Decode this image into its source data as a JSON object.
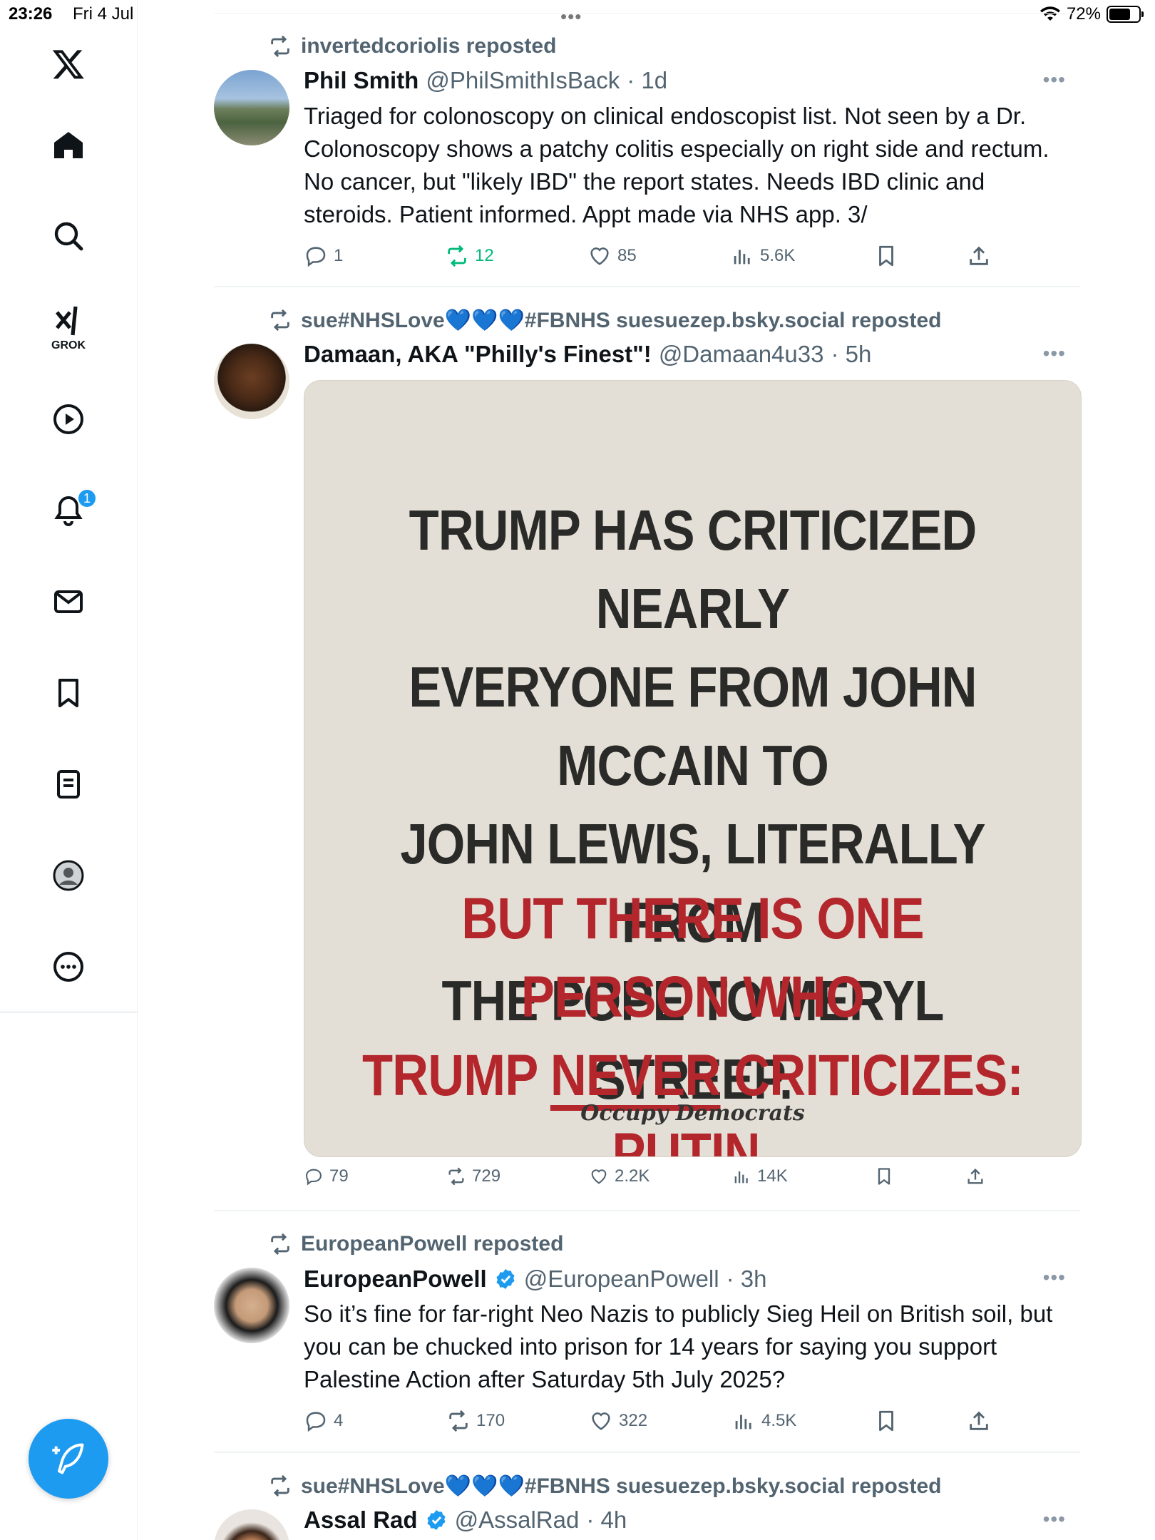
{
  "status_bar": {
    "time": "23:26",
    "date": "Fri 4 Jul",
    "battery": "72%",
    "battery_level": 0.72
  },
  "sidebar": {
    "grok_label": "GROK",
    "notifications_badge": "1"
  },
  "tweets": [
    {
      "repost_by": "invertedcoriolis reposted",
      "name": "Phil Smith",
      "handle": "@PhilSmithIsBack",
      "time": "· 1d",
      "text": "Triaged for colonoscopy on clinical endoscopist list. Not seen by a Dr. Colonoscopy shows a patchy colitis especially on right side and rectum. No cancer, but \"likely IBD\" the report states. Needs IBD clinic and steroids. Patient informed. Appt made via NHS app. 3/",
      "replies": "1",
      "reposts": "12",
      "likes": "85",
      "views": "5.6K"
    },
    {
      "repost_by": "sue#NHSLove💙💙💙#FBNHS suesuezep.bsky.social reposted",
      "name": "Damaan, AKA \"Philly's Finest\"!",
      "handle": "@Damaan4u33",
      "time": "· 5h",
      "image": {
        "line1": "TRUMP HAS CRITICIZED NEARLY",
        "line2": "EVERYONE FROM JOHN MCCAIN TO",
        "line3": "JOHN LEWIS, LITERALLY FROM",
        "line4": "THE POPE TO MERYL STREEP.",
        "line5": "BUT THERE IS ONE PERSON WHO",
        "line6_a": "TRUMP ",
        "line6_b": "NEVER",
        "line6_c": " CRITICIZES: ",
        "line6_d": "PUTIN",
        "line6_e": ".",
        "signature": "Occupy Democrats"
      },
      "replies": "79",
      "reposts": "729",
      "likes": "2.2K",
      "views": "14K"
    },
    {
      "repost_by": "EuropeanPowell reposted",
      "name": "EuropeanPowell",
      "handle": "@EuropeanPowell",
      "time": "· 3h",
      "text": "So it’s fine for far-right Neo Nazis to publicly Sieg Heil on British soil, but you can be chucked into prison for 14 years for saying you support Palestine Action after Saturday 5th July 2025?",
      "replies": "4",
      "reposts": "170",
      "likes": "322",
      "views": "4.5K"
    },
    {
      "repost_by": "sue#NHSLove💙💙💙#FBNHS suesuezep.bsky.social reposted",
      "name": "Assal Rad",
      "handle": "@AssalRad",
      "time": "· 4h"
    }
  ],
  "colors": {
    "accent": "#1d9bf0",
    "repost_green": "#00ba7c",
    "meme_red": "#b3262c",
    "secondary_text": "#536471"
  }
}
